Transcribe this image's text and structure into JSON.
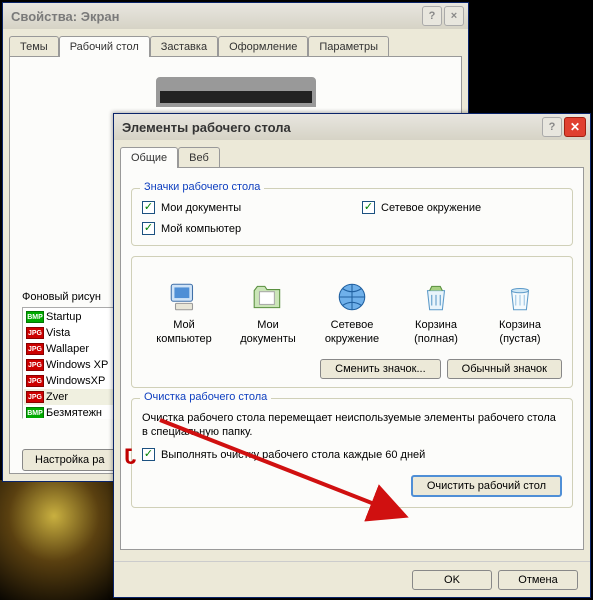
{
  "backWindow": {
    "title": "Свойства: Экран",
    "tabs": [
      "Темы",
      "Рабочий стол",
      "Заставка",
      "Оформление",
      "Параметры"
    ],
    "activeTabIndex": 1,
    "backgroundLabel": "Фоновый рисун",
    "backgroundItems": [
      {
        "tag": "BMP",
        "name": "Startup"
      },
      {
        "tag": "JPG",
        "name": "Vista"
      },
      {
        "tag": "JPG",
        "name": "Wallaper"
      },
      {
        "tag": "JPG",
        "name": "Windows XP"
      },
      {
        "tag": "JPG",
        "name": "WindowsXP"
      },
      {
        "tag": "JPG",
        "name": "Zver",
        "selected": true
      },
      {
        "tag": "BMP",
        "name": "Безмятежн"
      }
    ],
    "configureButton": "Настройка ра"
  },
  "frontWindow": {
    "title": "Элементы рабочего стола",
    "tabs": [
      "Общие",
      "Веб"
    ],
    "activeTabIndex": 0,
    "iconsGroup": {
      "legend": "Значки рабочего стола",
      "checkboxes": [
        {
          "label": "Мои документы",
          "checked": true
        },
        {
          "label": "Сетевое окружение",
          "checked": true
        },
        {
          "label": "Мой компьютер",
          "checked": true
        }
      ]
    },
    "iconCells": [
      {
        "label": "Мой компьютер"
      },
      {
        "label": "Мои документы"
      },
      {
        "label": "Сетевое окружение"
      },
      {
        "label": "Корзина (полная)"
      },
      {
        "label": "Корзина (пустая)"
      }
    ],
    "changeIconButton": "Сменить значок...",
    "defaultIconButton": "Обычный значок",
    "cleanupGroup": {
      "legend": "Очистка рабочего стола",
      "description": "Очистка рабочего стола перемещает неиспользуемые элементы рабочего стола в специальную папку.",
      "checkbox": {
        "label": "Выполнять очистку рабочего стола каждые 60 дней",
        "checked": true
      },
      "cleanupButton": "Очистить рабочий стол"
    },
    "okButton": "OK",
    "cancelButton": "Отмена"
  }
}
